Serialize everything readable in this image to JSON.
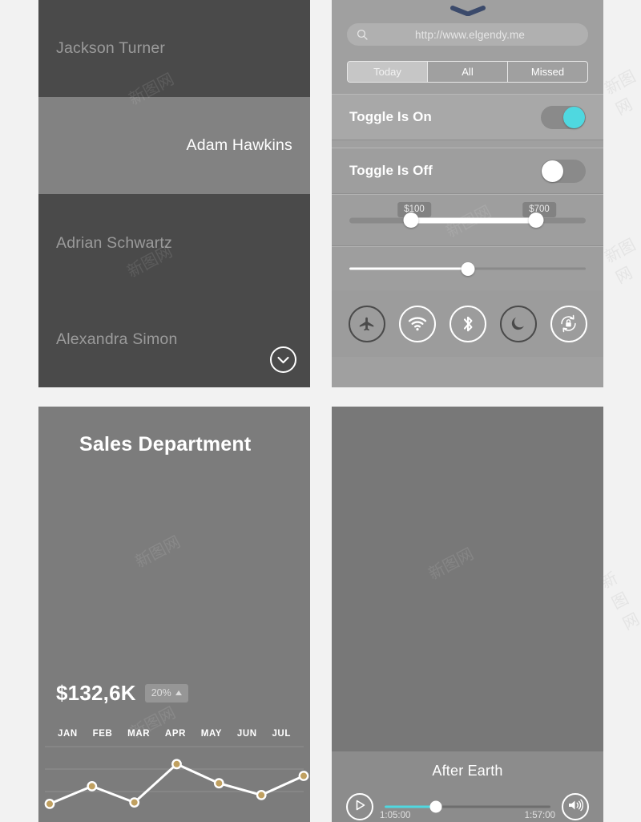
{
  "page": {
    "background": "#f2f2f2",
    "accent_cyan": "#4fd8e0",
    "marker_gold": "#c0a060"
  },
  "contacts_card": {
    "items": [
      {
        "name": "Jackson Turner",
        "align": "left",
        "theme": "dark"
      },
      {
        "name": "Adam Hawkins",
        "align": "right",
        "theme": "light"
      },
      {
        "name": "Adrian Schwartz",
        "align": "left",
        "theme": "dark"
      },
      {
        "name": "Alexandra Simon",
        "align": "left",
        "theme": "dark"
      }
    ],
    "fab_icon": "chevron-down-icon"
  },
  "settings_card": {
    "grabber_icon": "chevron-down-handle-icon",
    "grabber_color": "#3b4a6b",
    "search": {
      "icon": "search-icon",
      "value": "",
      "placeholder": "http://www.elgendy.me"
    },
    "segmented": {
      "options": [
        "Today",
        "All",
        "Missed"
      ],
      "selected": "Today"
    },
    "toggles": [
      {
        "label": "Toggle Is On",
        "state": "on",
        "knob_color": "#4fd8e0"
      },
      {
        "label": "Toggle Is Off",
        "state": "off",
        "knob_color": "#ffffff"
      }
    ],
    "range_slider": {
      "min_bubble": "$100",
      "max_bubble": "$700",
      "low_pct": 26,
      "high_pct": 79
    },
    "single_slider": {
      "value_pct": 50
    },
    "quick_icons": [
      {
        "name": "airplane-mode-icon",
        "active": false
      },
      {
        "name": "wifi-icon",
        "active": true
      },
      {
        "name": "bluetooth-icon",
        "active": true
      },
      {
        "name": "do-not-disturb-moon-icon",
        "active": false
      },
      {
        "name": "rotation-lock-icon",
        "active": true
      }
    ]
  },
  "sales_card": {
    "title": "Sales Department",
    "amount": "$132,6K",
    "change_badge": "20%",
    "change_direction": "up"
  },
  "chart_data": {
    "type": "line",
    "title": "Sales Department",
    "categories": [
      "JAN",
      "FEB",
      "MAR",
      "APR",
      "MAY",
      "JUN",
      "JUL"
    ],
    "values": [
      18,
      42,
      20,
      72,
      46,
      30,
      56
    ],
    "xlabel": "",
    "ylabel": "",
    "ylim": [
      0,
      100
    ],
    "grid": true,
    "legend": false,
    "line_color": "#ffffff",
    "marker_color": "#c0a060",
    "annotation": "$132,6K"
  },
  "video_card": {
    "title": "After Earth",
    "play_icon": "play-icon",
    "volume_icon": "volume-icon",
    "progress_pct": 31,
    "elapsed": "1:05:00",
    "remaining": "1:57:00"
  }
}
